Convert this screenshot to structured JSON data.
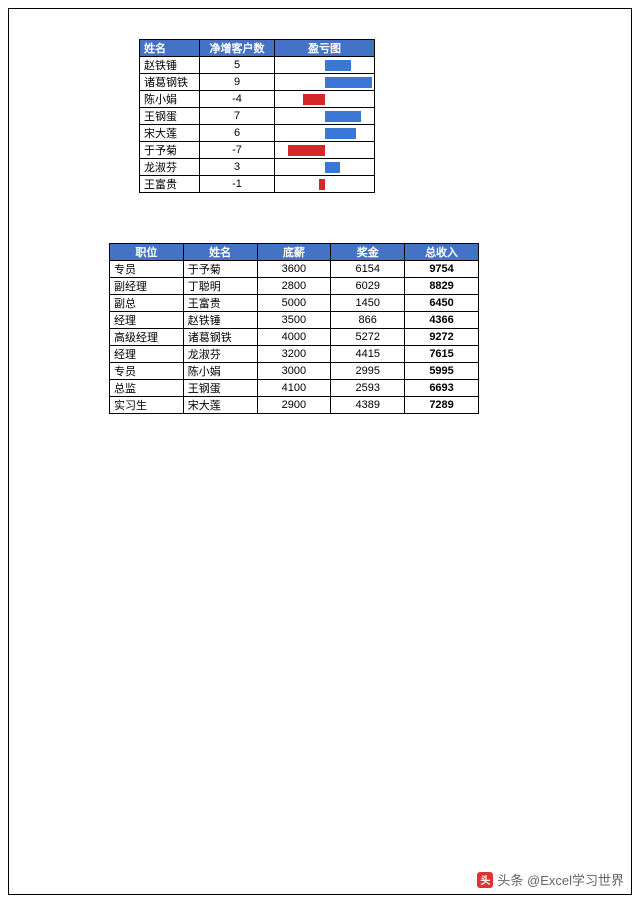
{
  "table1": {
    "headers": [
      "姓名",
      "净增客户数",
      "盈亏图"
    ],
    "rows": [
      {
        "name": "赵铁锤",
        "value": 5
      },
      {
        "name": "诸葛钢铁",
        "value": 9
      },
      {
        "name": "陈小娟",
        "value": -4
      },
      {
        "name": "王钢蛋",
        "value": 7
      },
      {
        "name": "宋大莲",
        "value": 6
      },
      {
        "name": "于予菊",
        "value": -7
      },
      {
        "name": "龙淑芬",
        "value": 3
      },
      {
        "name": "王富贵",
        "value": -1
      }
    ],
    "max_abs": 9
  },
  "table2": {
    "headers": [
      "职位",
      "姓名",
      "底薪",
      "奖金",
      "总收入"
    ],
    "rows": [
      {
        "position": "专员",
        "name": "于予菊",
        "base": 3600,
        "bonus": 6154,
        "total": 9754
      },
      {
        "position": "副经理",
        "name": "丁聪明",
        "base": 2800,
        "bonus": 6029,
        "total": 8829
      },
      {
        "position": "副总",
        "name": "王富贵",
        "base": 5000,
        "bonus": 1450,
        "total": 6450
      },
      {
        "position": "经理",
        "name": "赵铁锤",
        "base": 3500,
        "bonus": 866,
        "total": 4366
      },
      {
        "position": "高级经理",
        "name": "诸葛钢铁",
        "base": 4000,
        "bonus": 5272,
        "total": 9272
      },
      {
        "position": "经理",
        "name": "龙淑芬",
        "base": 3200,
        "bonus": 4415,
        "total": 7615
      },
      {
        "position": "专员",
        "name": "陈小娟",
        "base": 3000,
        "bonus": 2995,
        "total": 5995
      },
      {
        "position": "总监",
        "name": "王钢蛋",
        "base": 4100,
        "bonus": 2593,
        "total": 6693
      },
      {
        "position": "实习生",
        "name": "宋大莲",
        "base": 2900,
        "bonus": 4389,
        "total": 7289
      }
    ]
  },
  "watermark": {
    "icon_text": "头",
    "text": "头条 @Excel学习世界"
  },
  "chart_data": {
    "type": "bar",
    "title": "盈亏图",
    "xlabel": "姓名",
    "ylabel": "净增客户数",
    "categories": [
      "赵铁锤",
      "诸葛钢铁",
      "陈小娟",
      "王钢蛋",
      "宋大莲",
      "于予菊",
      "龙淑芬",
      "王富贵"
    ],
    "values": [
      5,
      9,
      -4,
      7,
      6,
      -7,
      3,
      -1
    ],
    "ylim": [
      -9,
      9
    ],
    "colors": {
      "positive": "#3a78d8",
      "negative": "#d62728"
    }
  }
}
